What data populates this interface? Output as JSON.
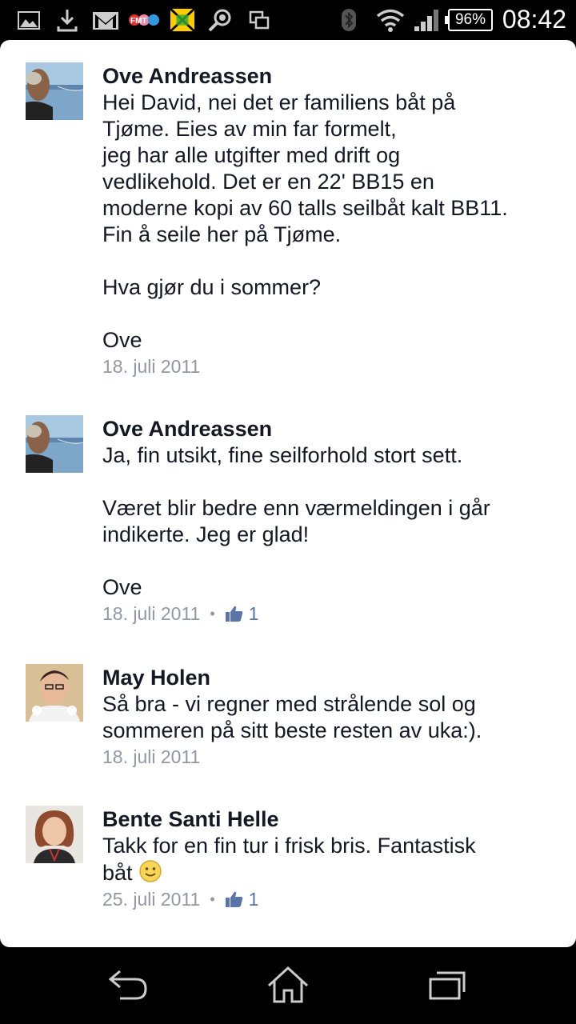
{
  "status_bar": {
    "battery": "96%",
    "time": "08:42",
    "icons": [
      "image-icon",
      "download-icon",
      "gmail-icon",
      "fmt-app-icon",
      "game-app-icon",
      "search-app-icon",
      "screens-icon",
      "bluetooth-icon",
      "wifi-icon",
      "signal-icon"
    ]
  },
  "comments": [
    {
      "author": "Ove Andreassen",
      "text": "Hei David, nei det er familiens båt på\nTjøme. Eies av min far formelt,\njeg har alle utgifter med drift og\nvedlikehold. Det er en 22' BB15 en\nmoderne kopi av 60 talls seilbåt kalt BB11.\nFin å seile her på Tjøme.\n\nHva gjør du i sommer?\n\nOve",
      "date": "18. juli 2011",
      "likes": null
    },
    {
      "author": "Ove Andreassen",
      "text": "Ja, fin utsikt, fine seilforhold stort sett.\n\nVæret blir bedre enn værmeldingen i går\nindikerte. Jeg er glad!\n\nOve",
      "date": "18. juli 2011",
      "likes": "1"
    },
    {
      "author": "May Holen",
      "text": "Så bra - vi regner med strålende sol og\nsommeren på sitt beste resten av uka:).",
      "date": "18. juli 2011",
      "likes": null
    },
    {
      "author": "Bente Santi Helle",
      "text": "Takk for en fin tur i frisk bris. Fantastisk\nbåt",
      "date": "25. juli 2011",
      "likes": "1"
    }
  ],
  "nav_bar": {
    "buttons": [
      "back-icon",
      "home-icon",
      "recent-apps-icon"
    ]
  },
  "colors": {
    "author": "#141823",
    "meta": "#9197a3",
    "like": "#5b74a8",
    "background": "#ffffff"
  }
}
